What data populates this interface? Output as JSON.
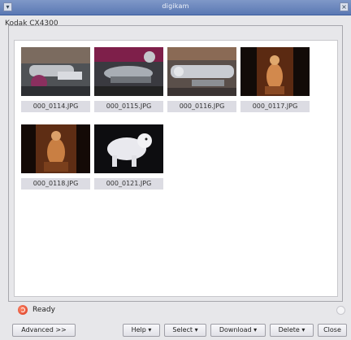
{
  "window": {
    "title": "digikam"
  },
  "camera": {
    "name": "Kodak CX4300"
  },
  "thumbnails": [
    {
      "filename": "000_0114.JPG"
    },
    {
      "filename": "000_0115.JPG"
    },
    {
      "filename": "000_0116.JPG"
    },
    {
      "filename": "000_0117.JPG"
    },
    {
      "filename": "000_0118.JPG"
    },
    {
      "filename": "000_0121.JPG"
    }
  ],
  "status": {
    "text": "Ready"
  },
  "buttons": {
    "advanced": "Advanced >>",
    "help": "Help",
    "select": "Select",
    "download": "Download",
    "delete": "Delete",
    "close": "Close"
  }
}
